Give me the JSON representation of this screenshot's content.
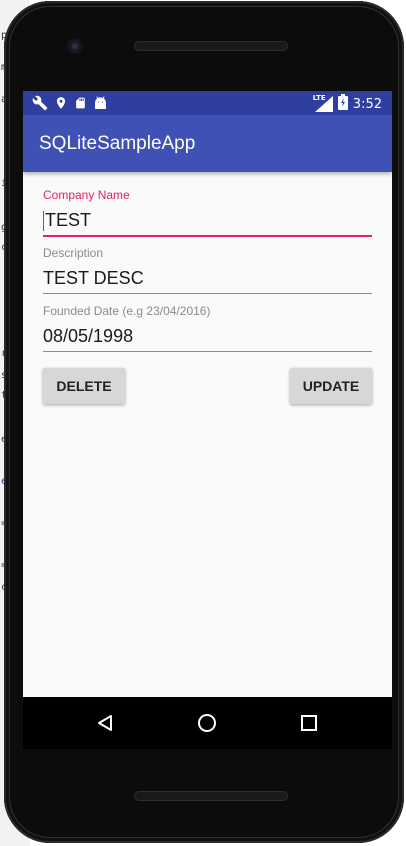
{
  "background_code": {
    "glyphs": [
      "p",
      "m",
      "a",
      "i",
      "g",
      "c",
      "r",
      "s",
      "t",
      "e",
      "e",
      "=",
      "=",
      "c"
    ]
  },
  "status_bar": {
    "time": "3:52",
    "network": "LTE",
    "left_icons": [
      "wrench-icon",
      "location-pin-icon",
      "sd-card-icon",
      "android-icon"
    ],
    "right_icons": [
      "signal-icon",
      "battery-charging-icon"
    ],
    "color": "#303f9f"
  },
  "app_bar": {
    "title": "SQLiteSampleApp",
    "color": "#3f51b5"
  },
  "form": {
    "company": {
      "label": "Company Name",
      "value": "TEST"
    },
    "description": {
      "label": "Description",
      "value": "TEST DESC"
    },
    "founded": {
      "label": "Founded Date (e.g 23/04/2016)",
      "value": "08/05/1998"
    }
  },
  "buttons": {
    "delete_label": "DELETE",
    "update_label": "UPDATE"
  },
  "nav_bar": {
    "icons": [
      "back-icon",
      "home-icon",
      "recents-icon"
    ]
  },
  "colors": {
    "accent": "#e91e63",
    "primary": "#3f51b5",
    "primary_dark": "#303f9f",
    "button": "#d6d7d7"
  }
}
